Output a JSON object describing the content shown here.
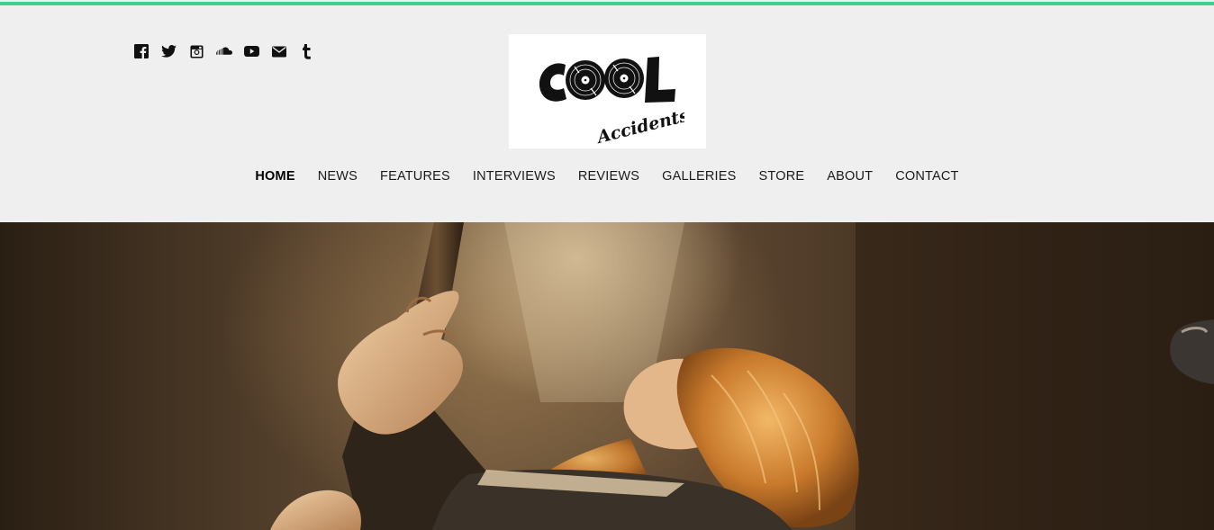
{
  "site": {
    "logo_text_main": "COOL",
    "logo_text_sub": "Accidents"
  },
  "social": {
    "icons": [
      "facebook-icon",
      "twitter-icon",
      "instagram-icon",
      "soundcloud-icon",
      "youtube-icon",
      "email-icon",
      "tumblr-icon"
    ]
  },
  "nav": {
    "items": [
      {
        "label": "HOME",
        "active": true
      },
      {
        "label": "NEWS"
      },
      {
        "label": "FEATURES"
      },
      {
        "label": "INTERVIEWS"
      },
      {
        "label": "REVIEWS"
      },
      {
        "label": "GALLERIES"
      },
      {
        "label": "STORE"
      },
      {
        "label": "ABOUT"
      },
      {
        "label": "CONTACT"
      }
    ]
  },
  "colors": {
    "accent": "#3ecf8e",
    "header_bg": "#efefef",
    "text": "#111111"
  }
}
